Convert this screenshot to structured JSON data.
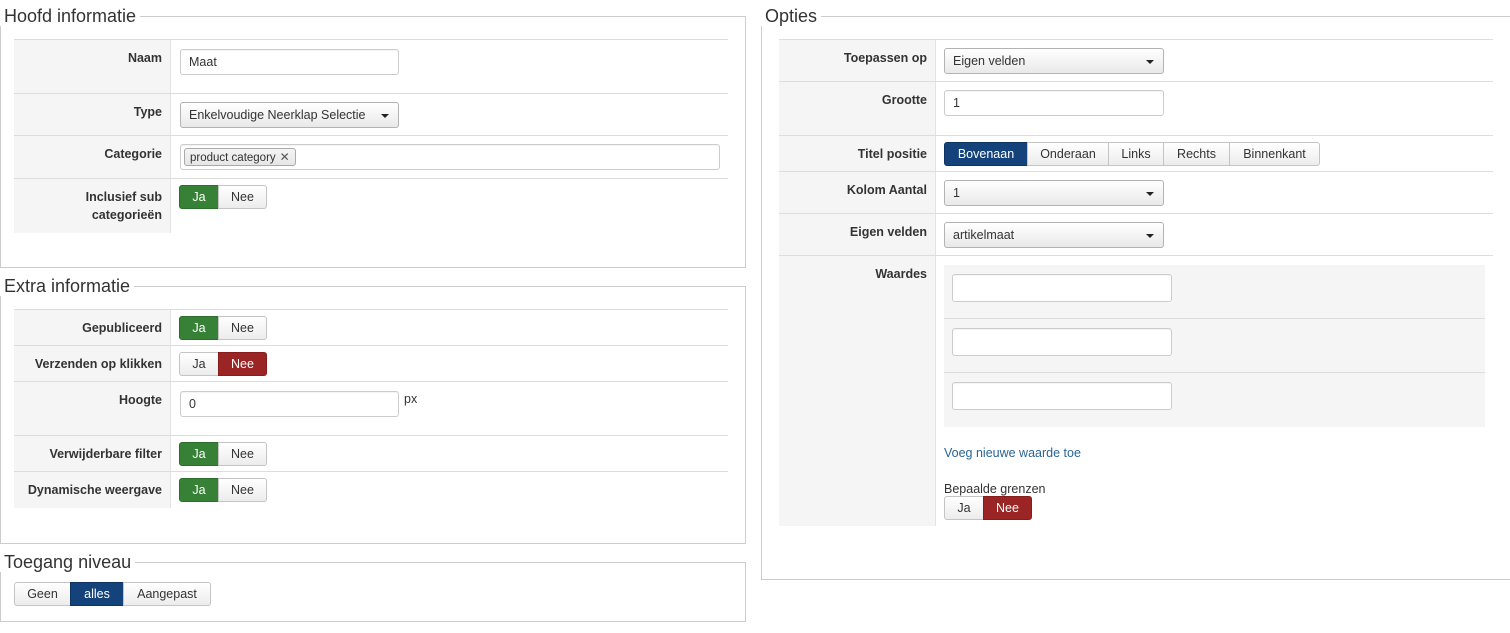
{
  "hoofd": {
    "legend": "Hoofd informatie",
    "naam_label": "Naam",
    "naam_value": "Maat",
    "type_label": "Type",
    "type_value": "Enkelvoudige Neerklap Selectie",
    "categorie_label": "Categorie",
    "categorie_tag": "product category",
    "sub_label": "Inclusief sub categorieën",
    "sub_ja": "Ja",
    "sub_nee": "Nee"
  },
  "extra": {
    "legend": "Extra informatie",
    "gepubliceerd_label": "Gepubliceerd",
    "verzenden_label": "Verzenden op klikken",
    "hoogte_label": "Hoogte",
    "hoogte_value": "0",
    "hoogte_unit": "px",
    "verwijderbare_label": "Verwijderbare filter",
    "dynamische_label": "Dynamische weergave",
    "ja": "Ja",
    "nee": "Nee"
  },
  "toegang": {
    "legend": "Toegang niveau",
    "options": [
      "Geen",
      "alles",
      "Aangepast"
    ],
    "selected": "alles"
  },
  "opties": {
    "legend": "Opties",
    "toepassen_label": "Toepassen op",
    "toepassen_value": "Eigen velden",
    "grootte_label": "Grootte",
    "grootte_value": "1",
    "titel_label": "Titel positie",
    "titel_options": [
      "Bovenaan",
      "Onderaan",
      "Links",
      "Rechts",
      "Binnenkant"
    ],
    "titel_selected": "Bovenaan",
    "kolom_label": "Kolom Aantal",
    "kolom_value": "1",
    "eigen_label": "Eigen velden",
    "eigen_value": "artikelmaat",
    "waardes_label": "Waardes",
    "waardes_values": [
      "",
      "",
      ""
    ],
    "add_link": "Voeg nieuwe waarde toe",
    "grenzen_label": "Bepaalde grenzen",
    "grenzen_ja": "Ja",
    "grenzen_nee": "Nee"
  },
  "colors": {
    "green": "#378137",
    "red": "#9b2424",
    "blue": "#13437a",
    "link": "#2a6496"
  }
}
